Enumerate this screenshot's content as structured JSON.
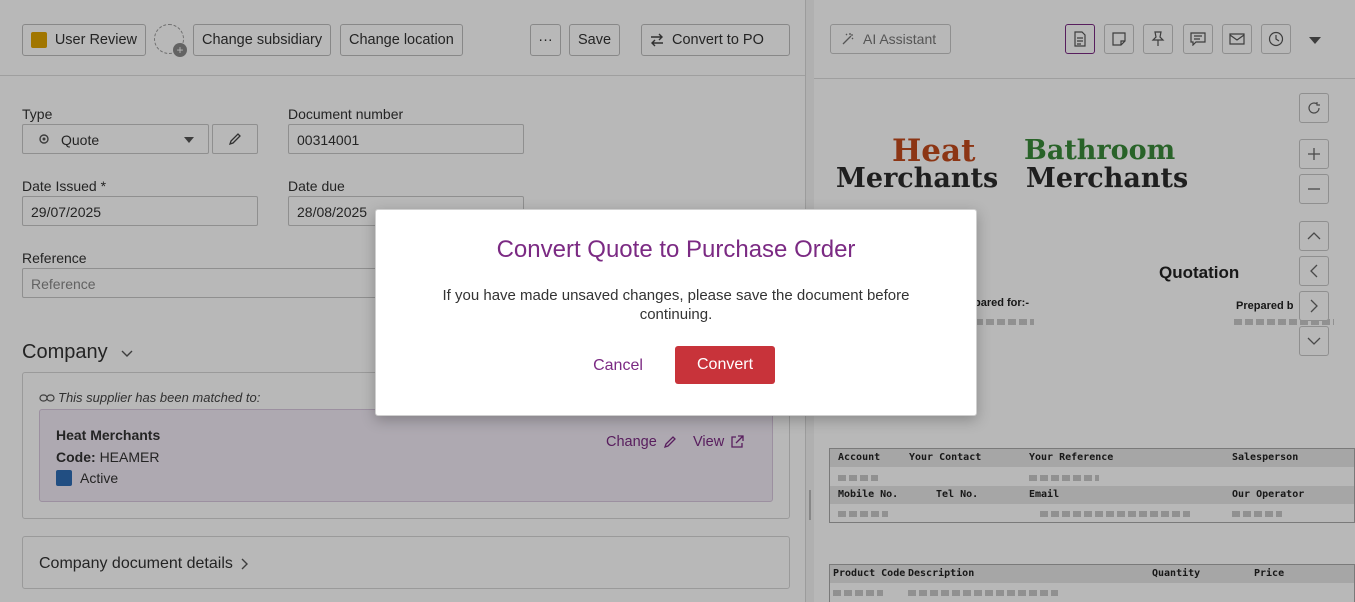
{
  "toolbar": {
    "status_label": "User Review",
    "change_subsidiary": "Change subsidiary",
    "change_location": "Change location",
    "more": "···",
    "save": "Save",
    "convert_po": "Convert to PO"
  },
  "form": {
    "type_label": "Type",
    "type_value": "Quote",
    "doc_number_label": "Document number",
    "doc_number_value": "00314001",
    "date_issued_label": "Date Issued *",
    "date_issued_value": "29/07/2025",
    "date_due_label": "Date due",
    "date_due_value": "28/08/2025",
    "reference_label": "Reference",
    "reference_placeholder": "Reference"
  },
  "company": {
    "section_title": "Company",
    "matched_note": "This supplier has been matched to:",
    "name": "Heat Merchants",
    "code_label": "Code:",
    "code_value": "HEAMER",
    "status": "Active",
    "change_link": "Change",
    "view_link": "View"
  },
  "company_details": {
    "title": "Company document details"
  },
  "right": {
    "ai_assistant": "AI Assistant",
    "logo_heat_1": "Heat",
    "logo_heat_2": "Merchants",
    "logo_bath_1": "Bathroom",
    "logo_bath_2": "Merchants",
    "doc_title": "Quotation",
    "prepared_for": "pared for:-",
    "prepared_by": "Prepared b",
    "table1_headers": [
      "Account",
      "Your Contact",
      "Your Reference",
      "Salesperson"
    ],
    "table1_headers2": [
      "Mobile No.",
      "Tel No.",
      "Email",
      "Our Operator"
    ],
    "table2_headers": [
      "Product Code",
      "Description",
      "Quantity",
      "Price"
    ]
  },
  "modal": {
    "title": "Convert Quote to Purchase Order",
    "message": "If you have made unsaved changes, please save the document before continuing.",
    "cancel": "Cancel",
    "convert": "Convert"
  },
  "colors": {
    "accent": "#7b2a83",
    "danger": "#c8333a",
    "status_pending": "#e0a400",
    "status_active": "#2f6cb5"
  }
}
